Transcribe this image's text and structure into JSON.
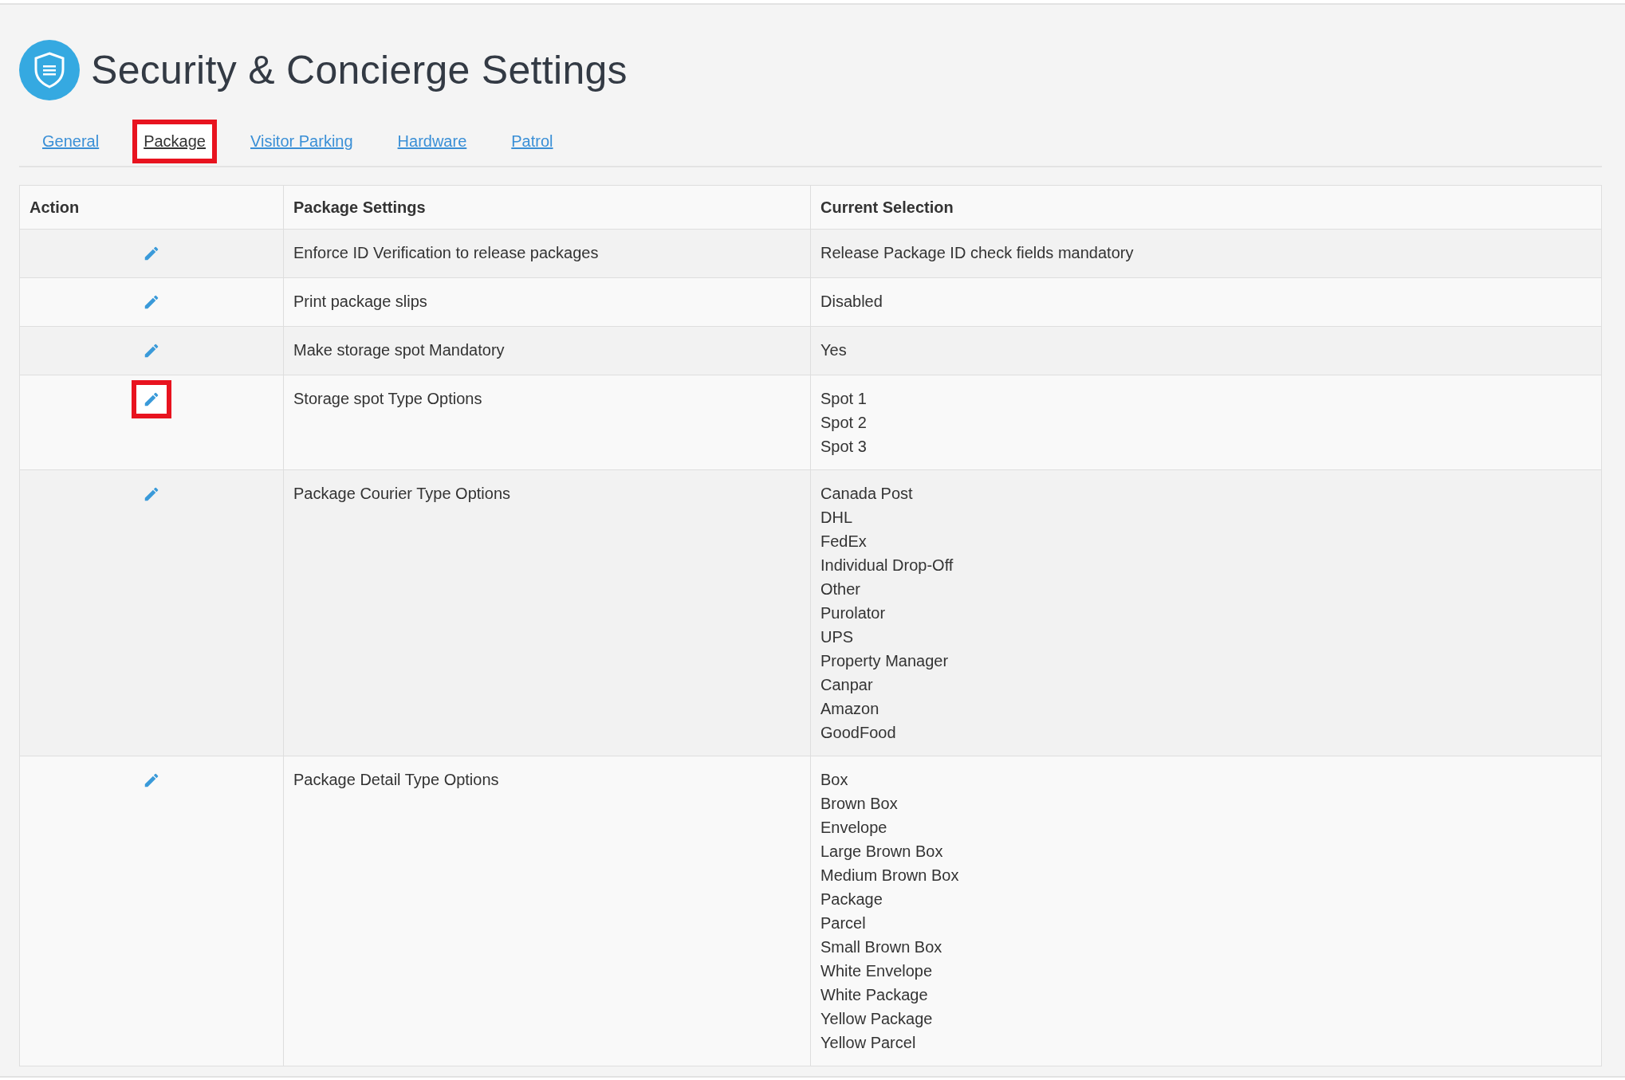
{
  "page": {
    "title": "Security & Concierge Settings"
  },
  "tabs": [
    {
      "label": "General",
      "selected": false,
      "highlighted": false
    },
    {
      "label": "Package",
      "selected": true,
      "highlighted": true
    },
    {
      "label": "Visitor Parking",
      "selected": false,
      "highlighted": false
    },
    {
      "label": "Hardware",
      "selected": false,
      "highlighted": false
    },
    {
      "label": "Patrol",
      "selected": false,
      "highlighted": false
    }
  ],
  "table": {
    "columns": [
      "Action",
      "Package Settings",
      "Current Selection"
    ],
    "rows": [
      {
        "setting": "Enforce ID Verification to release packages",
        "highlighted": false,
        "current": [
          "Release Package ID check fields mandatory"
        ]
      },
      {
        "setting": "Print package slips",
        "highlighted": false,
        "current": [
          "Disabled"
        ]
      },
      {
        "setting": "Make storage spot Mandatory",
        "highlighted": false,
        "current": [
          "Yes"
        ]
      },
      {
        "setting": "Storage spot Type Options",
        "highlighted": true,
        "current": [
          "Spot 1",
          "Spot 2",
          "Spot 3"
        ]
      },
      {
        "setting": "Package Courier Type Options",
        "highlighted": false,
        "current": [
          "Canada Post",
          "DHL",
          "FedEx",
          "Individual Drop-Off",
          "Other",
          "Purolator",
          "UPS",
          "Property Manager",
          "Canpar",
          "Amazon",
          "GoodFood"
        ]
      },
      {
        "setting": "Package Detail Type Options",
        "highlighted": false,
        "current": [
          "Box",
          "Brown Box",
          "Envelope",
          "Large Brown Box",
          "Medium Brown Box",
          "Package",
          "Parcel",
          "Small Brown Box",
          "White Envelope",
          "White Package",
          "Yellow Package",
          "Yellow Parcel"
        ]
      }
    ]
  }
}
